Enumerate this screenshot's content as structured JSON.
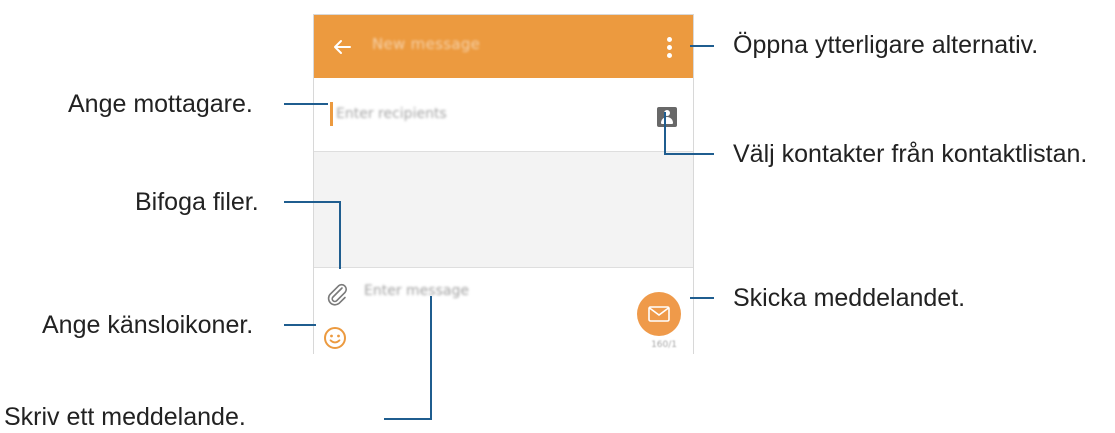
{
  "app": {
    "title": "New message",
    "recipient_placeholder": "Enter recipients",
    "message_placeholder": "Enter message",
    "send_counter": "160/1"
  },
  "annotations": {
    "more_options": "Öppna ytterligare alternativ.",
    "recipients": "Ange mottagare.",
    "contacts": "Välj kontakter från kontaktlistan.",
    "attach": "Bifoga filer.",
    "send": "Skicka meddelandet.",
    "emoticons": "Ange känsloikoner.",
    "compose": "Skriv ett meddelande."
  },
  "icons": {
    "back": "back-arrow-icon",
    "more": "more-options-icon",
    "contacts": "contacts-icon",
    "attach": "paperclip-icon",
    "emoji": "smiley-icon",
    "send": "envelope-icon"
  },
  "colors": {
    "header": "#ec9a3f",
    "send_button": "#ef9a4a",
    "callout_line": "#1f5d8f",
    "callout_text": "#222222"
  }
}
